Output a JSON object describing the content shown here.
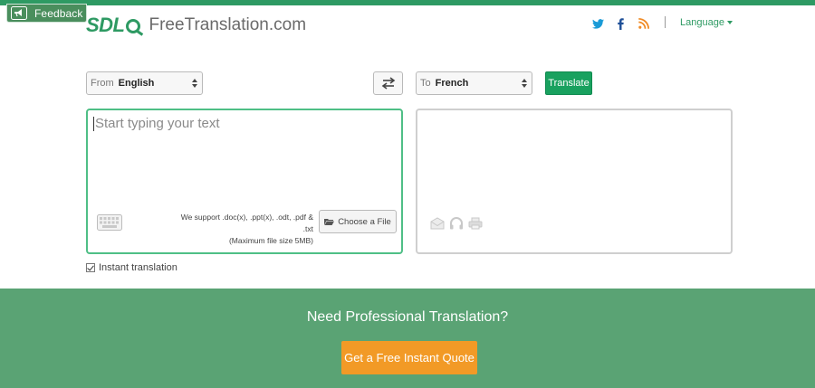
{
  "feedback": {
    "label": "Feedback",
    "icon": "megaphone-icon"
  },
  "logo": {
    "mark": "SDL",
    "brand": "FreeTranslation.com"
  },
  "header": {
    "social": [
      "twitter-icon",
      "facebook-icon",
      "rss-icon"
    ],
    "language_label": "Language"
  },
  "translator": {
    "from_label": "From",
    "from_value": "English",
    "to_label": "To",
    "to_value": "French",
    "translate_label": "Translate",
    "placeholder": "Start typing your text",
    "support_line1": "We support .doc(x), .ppt(x), .odt, .pdf & .txt",
    "support_line2": "(Maximum file size 5MB)",
    "file_button_label": "Choose a File",
    "instant_label": "Instant translation",
    "instant_checked": true
  },
  "banner": {
    "headline": "Need Professional Translation?",
    "cta_label": "Get a Free Instant Quote"
  },
  "colors": {
    "brand_green": "#2e9a63",
    "translate_green": "#19a15f",
    "banner_green": "#5aa374",
    "cta_orange": "#f29a26",
    "feedback_green": "#4a8e5d"
  }
}
